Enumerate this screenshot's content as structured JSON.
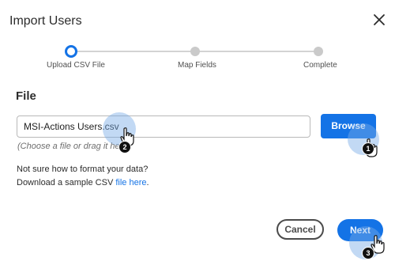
{
  "dialog": {
    "title": "Import Users",
    "close_icon": "close-icon"
  },
  "stepper": {
    "steps": [
      {
        "label": "Upload CSV File",
        "state": "active"
      },
      {
        "label": "Map Fields",
        "state": "pending"
      },
      {
        "label": "Complete",
        "state": "pending"
      }
    ]
  },
  "file_section": {
    "heading": "File",
    "input_value": "MSI-Actions Users.csv",
    "hint": "(Choose a file or drag it he",
    "browse_label": "Browse"
  },
  "help": {
    "line1": "Not sure how to format your data?",
    "line2_prefix": "Download a sample CSV ",
    "link_text": "file here",
    "line2_suffix": "."
  },
  "footer": {
    "cancel_label": "Cancel",
    "next_label": "Next"
  },
  "callouts": [
    {
      "number": "1",
      "target": "browse-button"
    },
    {
      "number": "2",
      "target": "file-input"
    },
    {
      "number": "3",
      "target": "next-button"
    }
  ],
  "colors": {
    "accent": "#1473e6",
    "halo": "#78aae6"
  }
}
